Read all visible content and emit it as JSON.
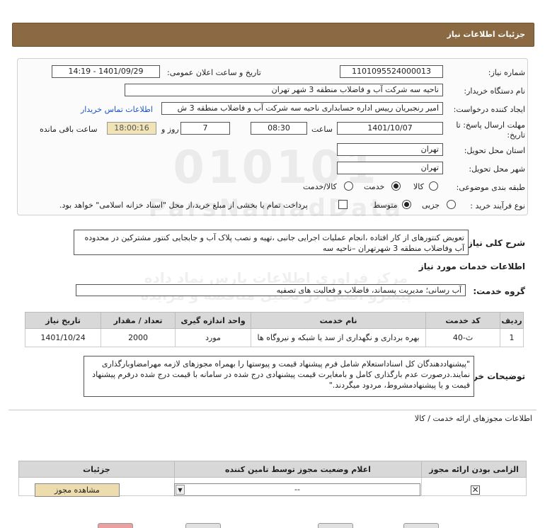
{
  "page": {
    "title": "جزئیات اطلاعات نیاز"
  },
  "watermark": {
    "line1": "010101",
    "line2": "ParsNamadData",
    "line3": "مرکز فراوری اطلاعات پارس نماد داده",
    "line4": "پیشرو اصلی در تحلیل مناقصه و مزایده"
  },
  "need": {
    "number_label": "شماره نیاز:",
    "number": "1101095524000013",
    "announce_label": "تاریخ و ساعت اعلان عمومی:",
    "announce": "1401/09/29 - 14:19",
    "buyer_label": "نام دستگاه خریدار:",
    "buyer": "ناحیه سه شرکت آب و فاضلاب منطقه 3 شهر تهران",
    "creator_label": "ایجاد کننده درخواست:",
    "creator": "امیر رنجبریان رییس اداره حسابداری ناحیه سه شرکت آب و فاضلاب منطقه 3 ش",
    "contact_link": "اطلاعات تماس خریدار",
    "deadline_label": "مهلت ارسال پاسخ: تا",
    "deadline_label2": "تاریخ:",
    "deadline_date": "1401/10/07",
    "time_label": "ساعت",
    "deadline_time": "08:30",
    "days": "7",
    "days_label": "روز و",
    "remaining_time": "18:00:16",
    "remaining_label": "ساعت باقی مانده",
    "province_label": "استان محل تحویل:",
    "province": "تهران",
    "city_label": "شهر محل تحویل:",
    "city": "تهران",
    "category_label": "طبقه بندی موضوعی:",
    "category_options": [
      "کالا",
      "خدمت",
      "کالا/خدمت"
    ],
    "category_selected": "خدمت",
    "process_label": "نوع فرآیند خرید :",
    "process_options": [
      "جزیی",
      "متوسط"
    ],
    "process_selected": "متوسط",
    "payment_note": "پرداخت تمام یا بخشی از مبلغ خرید،از محل \"اسناد خزانه اسلامی\" خواهد بود."
  },
  "summary": {
    "label": "شرح کلی نیاز:",
    "text": "تعویض کنتورهای از کار افتاده ،انجام عملیات اجرایی جانبی ،تهیه و نصب پلاک آب و جابجایی کنتور مشترکین در محدوده آب وفاضلاب منطقه 3 شهرتهران –ناحیه سه"
  },
  "services": {
    "title": "اطلاعات خدمات مورد نیاز",
    "group_label": "گروه خدمت:",
    "group": "آب رسانی؛ مدیریت پسماند، فاضلاب و فعالیت های تصفیه",
    "columns": [
      "ردیف",
      "کد خدمت",
      "نام خدمت",
      "واحد اندازه گیری",
      "تعداد / مقدار",
      "تاریخ نیاز"
    ],
    "rows": [
      {
        "row": "1",
        "code": "ث-40",
        "name": "بهره برداری و نگهداری از سد یا شبکه و نیروگاه ها",
        "unit": "مورد",
        "qty": "2000",
        "date": "1401/10/24"
      }
    ]
  },
  "buyer_notes": {
    "label": "توضیحات خریدار:",
    "text": "\"پیشنهاددهندگان کل اسناداستعلام شامل فرم پیشنهاد قیمت و پیوستها را بهمراه مجوزهای لازمه مهرامضاوبارگذاری نمایند.درصورت عدم بارگذاری کامل و بامغایرت قیمت پیشنهادی درج شده در سامانه با قیمت درج شده درفرم پیشنهاد قیمت و یا پیشنهادمشروط، مردود میگردند.\""
  },
  "permits": {
    "title": "اطلاعات مجوزهای ارائه خدمت / کالا",
    "columns": [
      "الزامی بودن ارائه مجوز",
      "اعلام وضعیت مجوز توسط تامین کننده",
      "جزئیات"
    ],
    "status_value": "--",
    "view_button": "مشاهده مجوز"
  }
}
